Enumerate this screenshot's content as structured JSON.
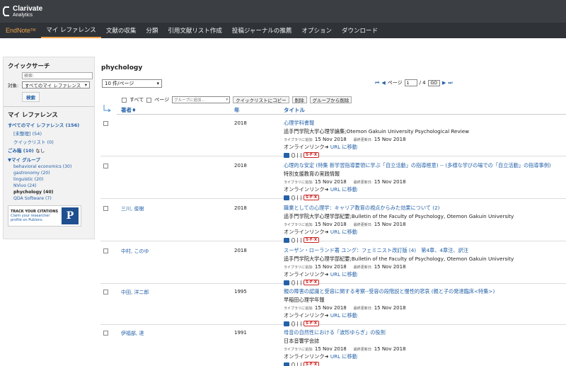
{
  "header": {
    "logo_name": "Clarivate",
    "logo_sub": "Analytics"
  },
  "nav": {
    "brand": "EndNote",
    "brand_sup": "TM",
    "items": [
      "マイ レファレンス",
      "文献の収集",
      "分類",
      "引用文献リスト作成",
      "投稿ジャーナルの推薦",
      "オプション",
      "ダウンロード"
    ]
  },
  "sidebar": {
    "quick_search_title": "クイックサーチ",
    "search_placeholder": "検索:",
    "target_label": "対象:",
    "target_value": "すべてのマイ レファレンス",
    "search_button": "検索",
    "my_refs_title": "マイ レファレンス",
    "all_refs": "すべてのマイ レファレンス (156)",
    "unfiled": "[未整理] (54)",
    "quick_list": "クイックリスト (0)",
    "trash": "ごみ箱 (10)",
    "trash_empty": "なし",
    "my_groups": "▼マイ グループ",
    "groups": [
      "behavioral economics  (30)",
      "gastronomy  (20)",
      "linguistic  (20)",
      "NVivo  (24)",
      "phychology  (40)",
      "QDA Software  (7)"
    ],
    "publons_line1": "TRACK YOUR CITATIONS",
    "publons_line2": "Claim your researcher",
    "publons_line3": "profile on Publons",
    "publons_logo": "P"
  },
  "main": {
    "title": "phychology",
    "per_page": "10 件/ページ",
    "page_label": "ページ",
    "page_value": "1",
    "page_total": "/ 4",
    "go": "GO",
    "select_all": "すべて",
    "select_page": "ページ",
    "group_select": "グループに追加...",
    "copy_btn": "クイックリストにコピー",
    "delete_btn": "削除",
    "remove_btn": "グループから削除",
    "col_author": "著者♦",
    "col_year": "年",
    "col_title": "タイトル",
    "added_label": "ライブラリに追加:",
    "updated_label": "最終更新日:",
    "online_link": "オンラインリンク",
    "url_link": "URL に移動",
    "sfx": "S·F·X"
  },
  "rows": [
    {
      "author": "",
      "year": "2018",
      "title": "心理学科書報",
      "source": "追手門学院大学心理学論集;Otemon Gakuin University Psychological Review",
      "added": "15 Nov 2018",
      "updated": "15 Nov 2018"
    },
    {
      "author": "",
      "year": "2018",
      "title": "心理的な安定 (特集 新学習指導要領に学ぶ「自立活動」の指導極意) -- (多様な学びの場での「自立活動」の指導事例)",
      "source": "特別支援教育の実践情報",
      "added": "15 Nov 2018",
      "updated": "15 Nov 2018"
    },
    {
      "author": "三川, 俊樹",
      "year": "2018",
      "title": "職業としての心理学：キャリア教育の視点からみた効果について (2)",
      "source": "追手門学院大学心理学部紀要;Bulletin of the Faculty of Psychology, Otemon Gakuin University",
      "added": "15 Nov 2018",
      "updated": "15 Nov 2018"
    },
    {
      "author": "中村, このゆ",
      "year": "2018",
      "title": "スーザン・ローランド著 ユング：フェミニスト改訂版 (4)　第4章、4章注、訳注",
      "source": "追手門学院大学心理学部紀要;Bulletin of the Faculty of Psychology, Otemon Gakuin University",
      "added": "15 Nov 2018",
      "updated": "15 Nov 2018"
    },
    {
      "author": "中田, 洋二郎",
      "year": "1995",
      "title": "親の障害の認識と受容に関する考察--受容の段階説と慢性的悲哀 (親と子の発達臨床<特集>)",
      "source": "早稲田心理学年報",
      "added": "15 Nov 2018",
      "updated": "15 Nov 2018"
    },
    {
      "author": "伊福部, 達",
      "year": "1991",
      "title": "母音の自然性における「波形ゆらぎ」の役割",
      "source": "日本音響学会誌",
      "added": "15 Nov 2018",
      "updated": "15 Nov 2018"
    }
  ]
}
